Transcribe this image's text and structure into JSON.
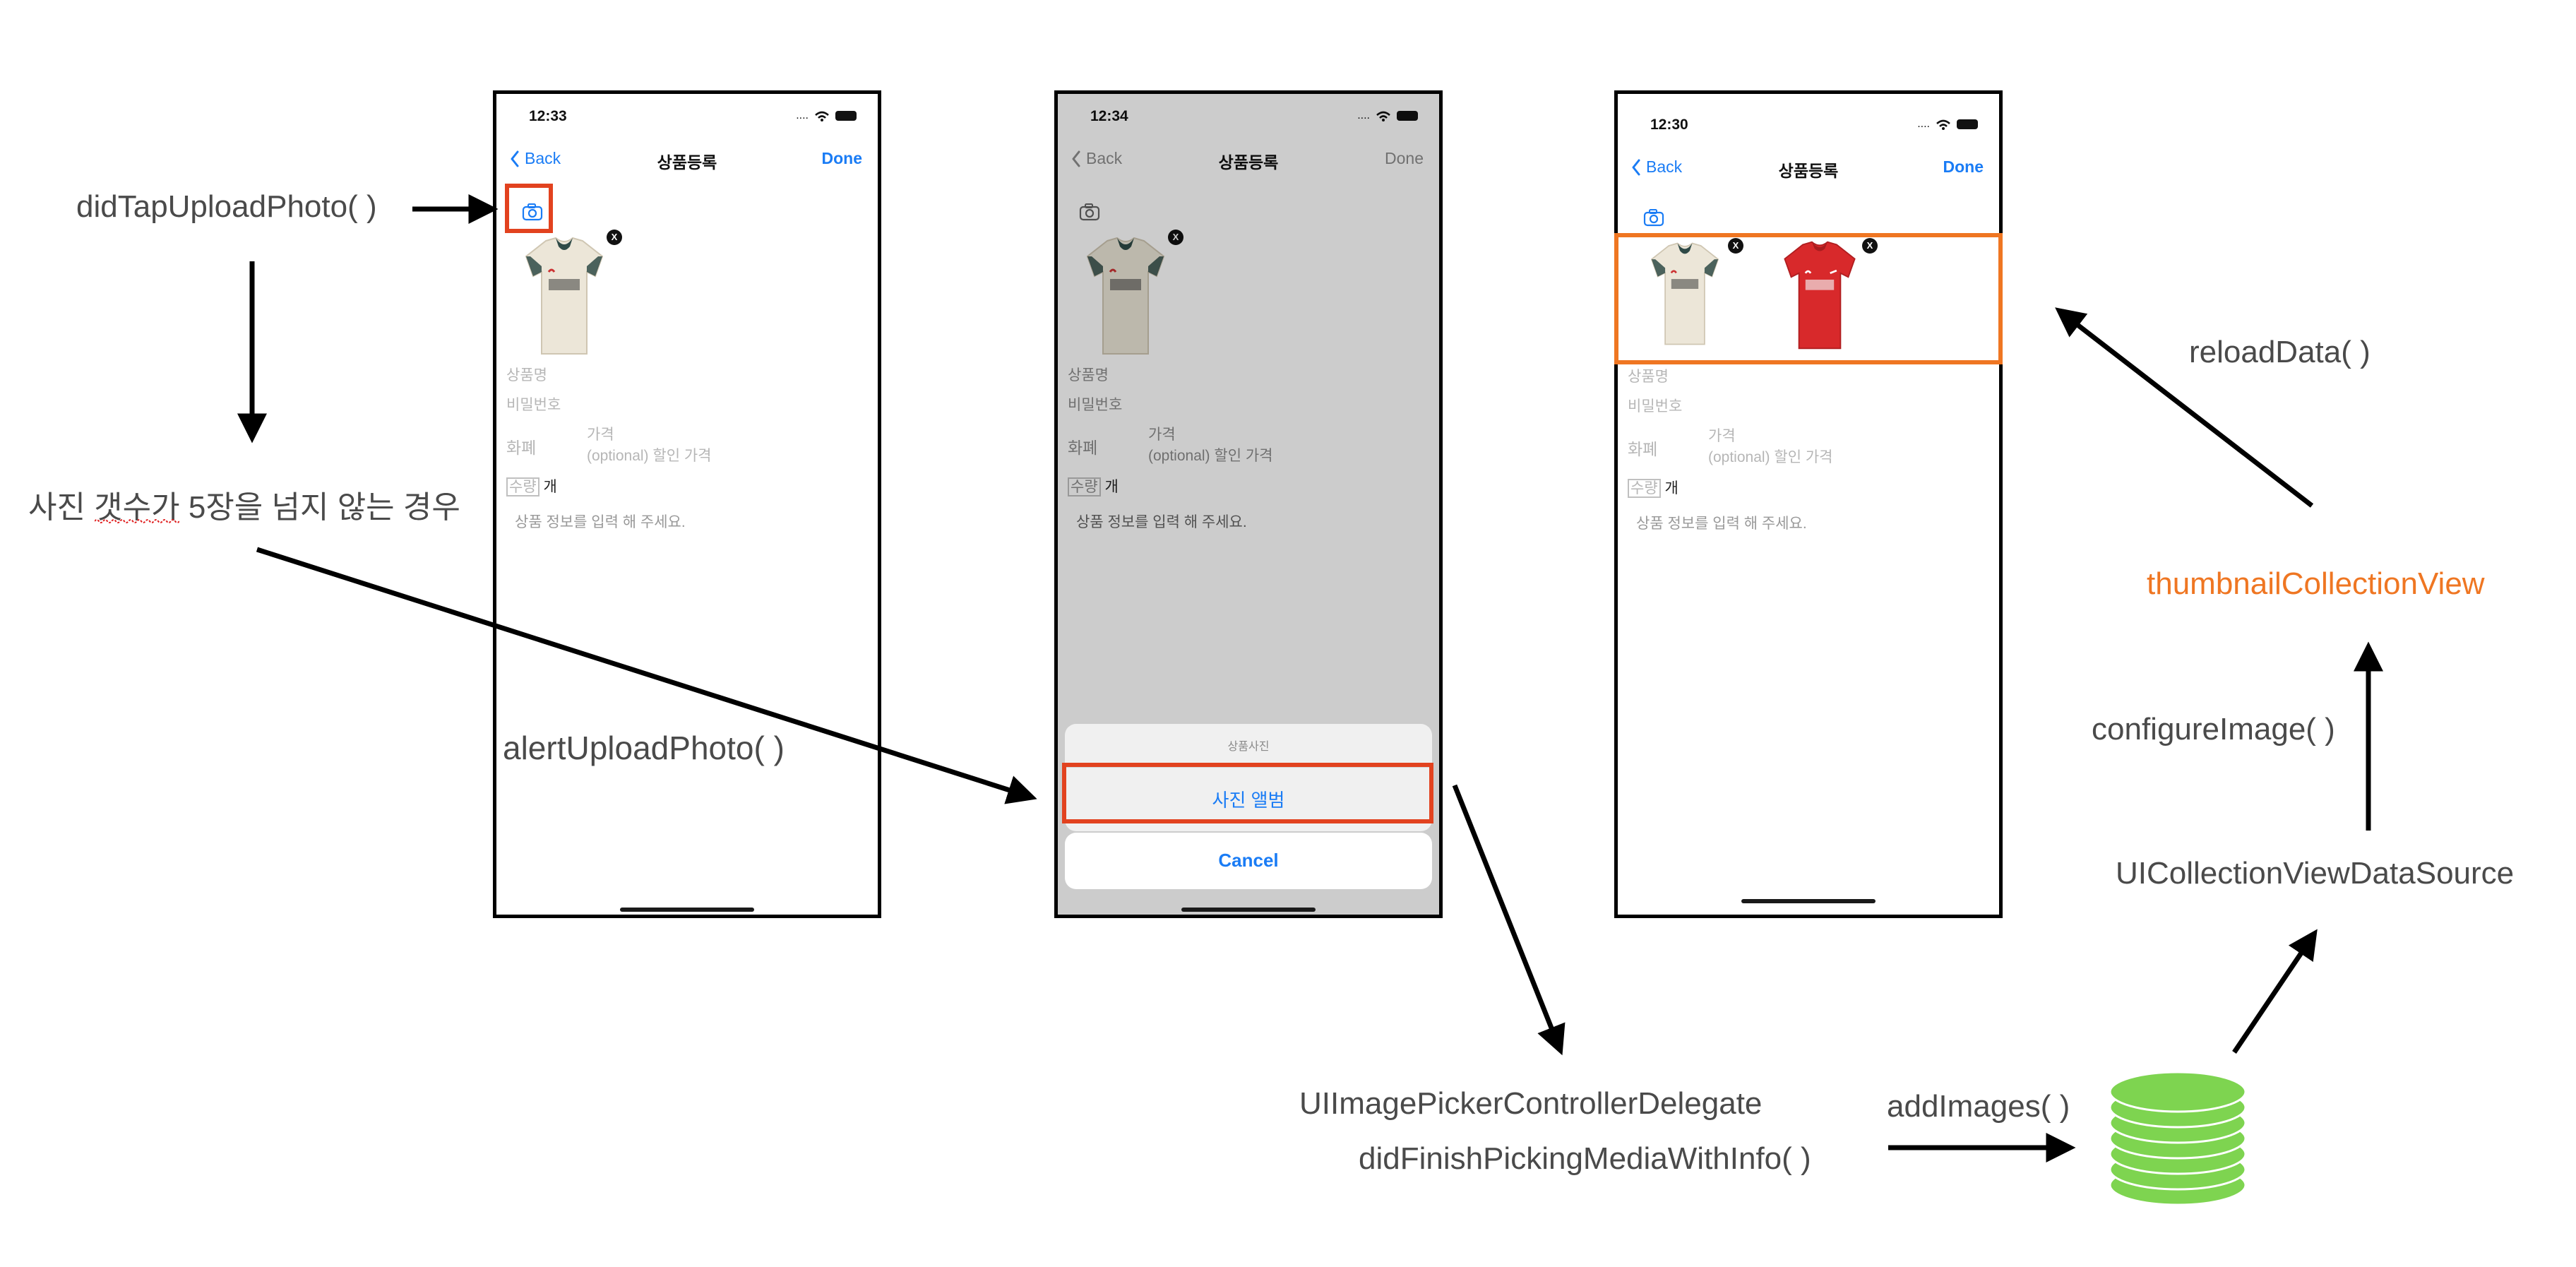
{
  "labels": {
    "did_tap_upload_photo": "didTapUploadPhoto( )",
    "condition": "사진 갯수가 5장을 넘지 않는 경우",
    "alert_upload_photo": "alertUploadPhoto( )",
    "picker_delegate": "UIImagePickerControllerDelegate",
    "did_finish_picking": "didFinishPickingMediaWithInfo( )",
    "add_images": "addImages( )",
    "data_source": "UICollectionViewDataSource",
    "configure_image": "configureImage( )",
    "thumbnail_collection_view": "thumbnailCollectionView",
    "reload_data": "reloadData( )"
  },
  "colors": {
    "highlight_red": "#e2421f",
    "highlight_orange": "#ef7622",
    "ios_blue": "#1a7cf5",
    "database_green": "#7ed450",
    "label_gray": "#4a4a4a"
  },
  "screens": [
    {
      "time": "12:33",
      "signal": "....",
      "back": "Back",
      "title": "상품등록",
      "done": "Done",
      "fields": {
        "name": "상품명",
        "password": "비밀번호",
        "currency": "화폐",
        "price": "가격",
        "discount": "(optional) 할인 가격",
        "quantity": "수량",
        "quantity_unit": "개",
        "description": "상품 정보를 입력 해 주세요."
      },
      "remove_badge": "X"
    },
    {
      "time": "12:34",
      "signal": "....",
      "back": "Back",
      "title": "상품등록",
      "done": "Done",
      "fields": {
        "name": "상품명",
        "password": "비밀번호",
        "currency": "화폐",
        "price": "가격",
        "discount": "(optional) 할인 가격",
        "quantity": "수량",
        "quantity_unit": "개",
        "description": "상품 정보를 입력 해 주세요."
      },
      "remove_badge": "X",
      "action_sheet": {
        "title": "상품사진",
        "album": "사진 앨범",
        "cancel": "Cancel"
      }
    },
    {
      "time": "12:30",
      "signal": "....",
      "back": "Back",
      "title": "상품등록",
      "done": "Done",
      "fields": {
        "name": "상품명",
        "password": "비밀번호",
        "currency": "화폐",
        "price": "가격",
        "discount": "(optional) 할인 가격",
        "quantity": "수량",
        "quantity_unit": "개",
        "description": "상품 정보를 입력 해 주세요."
      },
      "remove_badge": "X"
    }
  ]
}
